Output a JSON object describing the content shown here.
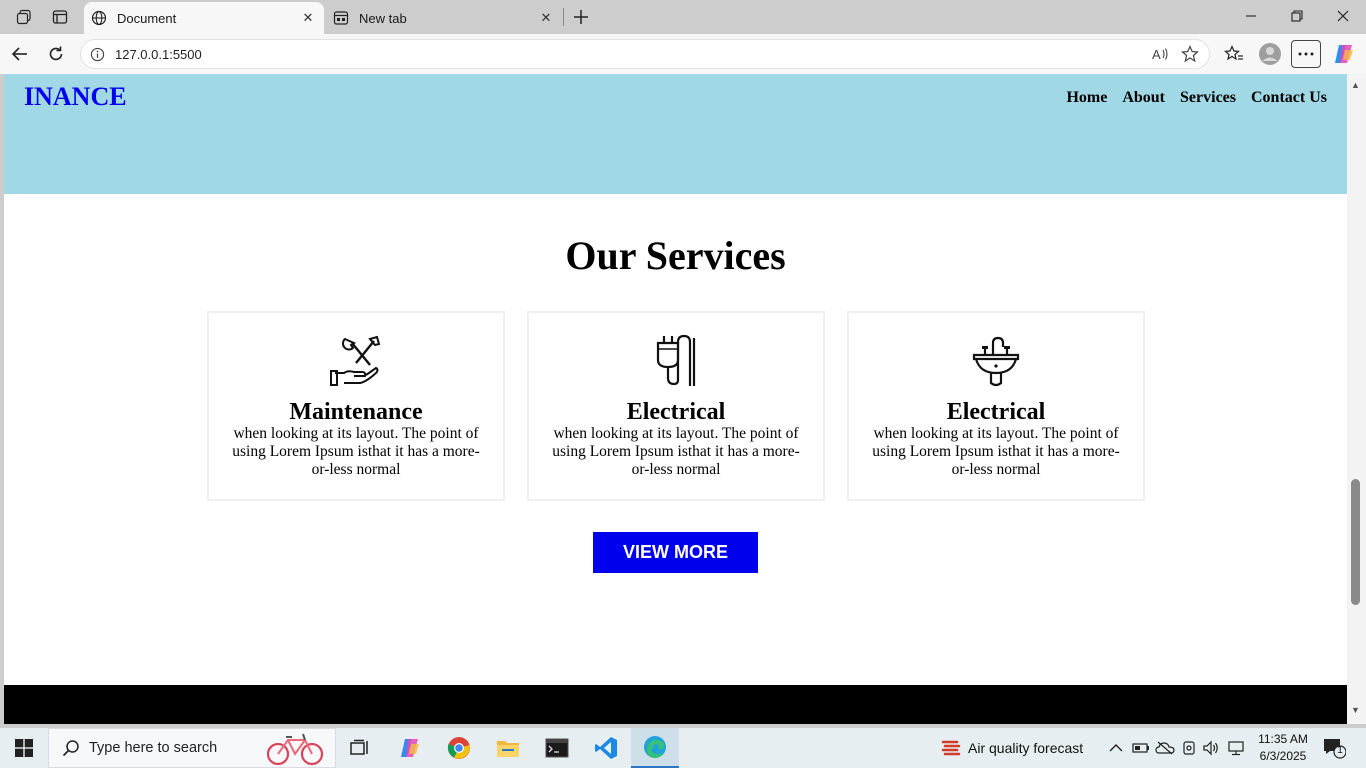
{
  "browser": {
    "tabs": [
      {
        "title": "Document",
        "active": true,
        "icon": "globe-icon"
      },
      {
        "title": "New tab",
        "active": false,
        "icon": "new-tab-page-icon"
      }
    ],
    "close_glyph": "✕",
    "url": "127.0.0.1:5500"
  },
  "page": {
    "brand": "INANCE",
    "nav": [
      "Home",
      "About",
      "Services",
      "Contact Us"
    ],
    "services_title": "Our Services",
    "cards": [
      {
        "icon": "wrench-hand-icon",
        "title": "Maintenance",
        "text": "when looking at its layout. The point of using Lorem Ipsum isthat it has a more-or-less normal"
      },
      {
        "icon": "electric-plug-icon",
        "title": "Electrical",
        "text": "when looking at its layout. The point of using Lorem Ipsum isthat it has a more-or-less normal"
      },
      {
        "icon": "sink-icon",
        "title": "Electrical",
        "text": "when looking at its layout. The point of using Lorem Ipsum isthat it has a more-or-less normal"
      }
    ],
    "view_more": "VIEW MORE",
    "colors": {
      "hero": "#a0d8e6",
      "accent": "#0000ee",
      "footer": "#000000"
    }
  },
  "taskbar": {
    "search_placeholder": "Type here to search",
    "weather": "Air quality forecast",
    "time": "11:35 AM",
    "date": "6/3/2025",
    "notifications": "1"
  }
}
